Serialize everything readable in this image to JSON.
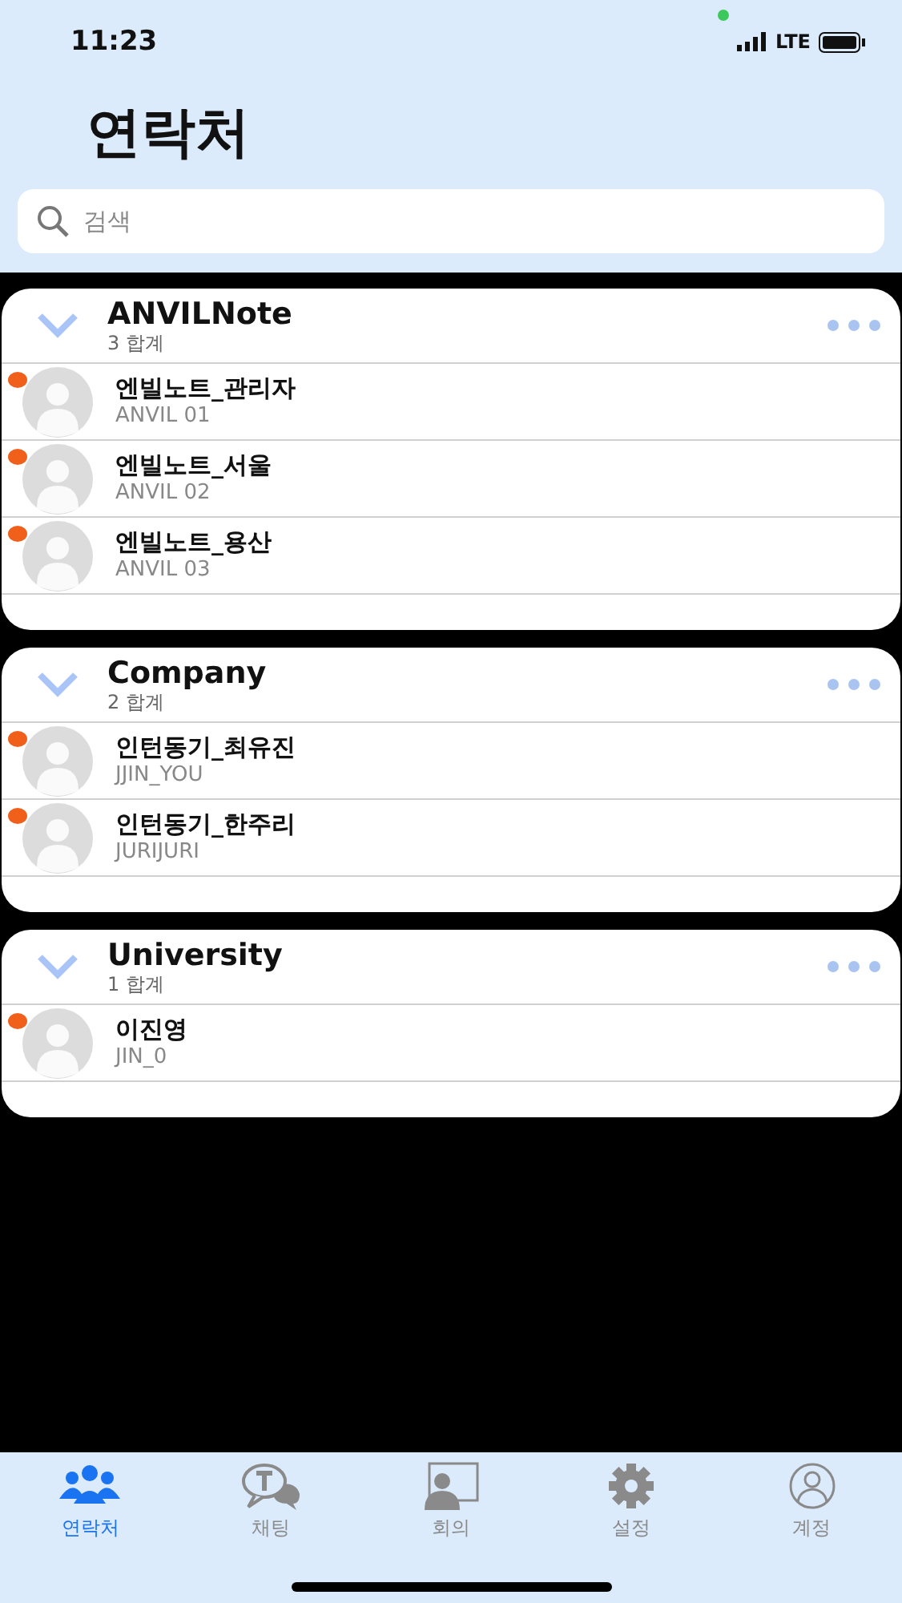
{
  "status_bar": {
    "time": "11:23",
    "network": "LTE"
  },
  "title": "연락처",
  "search": {
    "placeholder": "검색"
  },
  "groups": [
    {
      "name": "ANVILNote",
      "count": "3 합계",
      "expanded": true,
      "contacts": [
        {
          "name": "엔빌노트_관리자",
          "id": "ANVIL 01",
          "online": true
        },
        {
          "name": "엔빌노트_서울",
          "id": "ANVIL 02",
          "online": true
        },
        {
          "name": "엔빌노트_용산",
          "id": "ANVIL 03",
          "online": true
        }
      ]
    },
    {
      "name": "Company",
      "count": "2 합계",
      "expanded": true,
      "contacts": [
        {
          "name": "인턴동기_최유진",
          "id": "JJIN_YOU",
          "online": true
        },
        {
          "name": "인턴동기_한주리",
          "id": "JURIJURI",
          "online": true
        }
      ]
    },
    {
      "name": "University",
      "count": "1 합계",
      "expanded": true,
      "contacts": [
        {
          "name": "이진영",
          "id": "JIN_0",
          "online": true
        }
      ]
    }
  ],
  "tabs": [
    {
      "kind": "contacts",
      "label": "연락처",
      "selected": true
    },
    {
      "kind": "chat",
      "label": "채팅",
      "selected": false
    },
    {
      "kind": "meeting",
      "label": "회의",
      "selected": false
    },
    {
      "kind": "settings",
      "label": "설정",
      "selected": false
    },
    {
      "kind": "account",
      "label": "계정",
      "selected": false
    }
  ]
}
